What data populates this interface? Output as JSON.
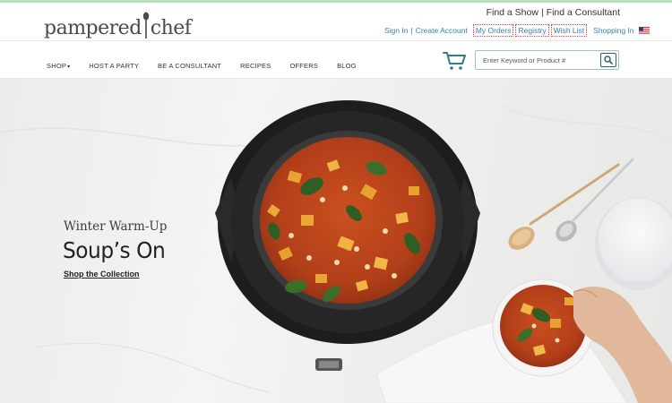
{
  "header": {
    "logo_text_left": "pampered",
    "logo_text_right": "chef",
    "find_a_show": "Find a Show",
    "find_sep": "|",
    "find_a_consultant": "Find a Consultant",
    "sign_in": "Sign In",
    "acct_sep": "|",
    "create_account": "Create Account",
    "my_orders": "My Orders",
    "registry": "Registry",
    "wish_list": "Wish List",
    "shopping_in": "Shopping In",
    "flag_icon": "us-flag-icon"
  },
  "nav": {
    "items": [
      {
        "label": "SHOP",
        "has_caret": true
      },
      {
        "label": "HOST A PARTY"
      },
      {
        "label": "BE A CONSULTANT"
      },
      {
        "label": "RECIPES"
      },
      {
        "label": "OFFERS"
      },
      {
        "label": "BLOG"
      }
    ],
    "caret": "▾",
    "cart_icon": "shopping-cart-icon"
  },
  "search": {
    "placeholder": "Enter Keyword or Product #",
    "button_icon": "search-icon"
  },
  "hero": {
    "eyebrow": "Winter Warm-Up",
    "title": "Soup’s On",
    "cta": "Shop the Collection"
  },
  "colors": {
    "link_blue": "#3e7fa8",
    "cart_teal": "#2d7f8f",
    "search_border": "#9cc7c1",
    "soup_red": "#b8421e",
    "marble": "#eeeeec"
  }
}
